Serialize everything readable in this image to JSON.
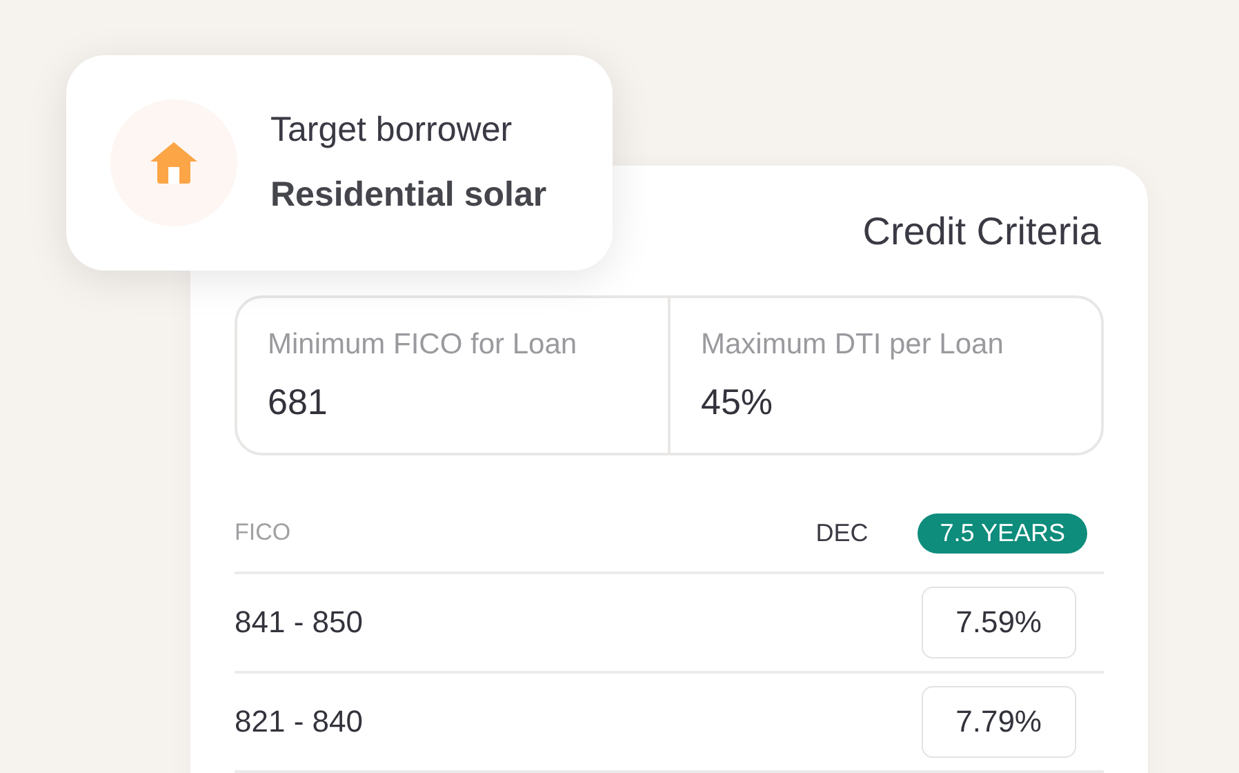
{
  "borrower_card": {
    "label": "Target borrower",
    "value": "Residential solar"
  },
  "credit_card": {
    "title": "Credit Criteria",
    "stats": [
      {
        "label": "Minimum FICO for Loan",
        "value": "681"
      },
      {
        "label": "Maximum DTI per Loan",
        "value": "45%"
      }
    ],
    "table": {
      "first_column": "FICO",
      "terms": [
        {
          "label": "DEC",
          "selected": false
        },
        {
          "label": "7.5 YEARS",
          "selected": true
        }
      ],
      "rows": [
        {
          "range": "841 - 850",
          "rate": "7.59%"
        },
        {
          "range": "821 - 840",
          "rate": "7.79%"
        }
      ]
    }
  }
}
